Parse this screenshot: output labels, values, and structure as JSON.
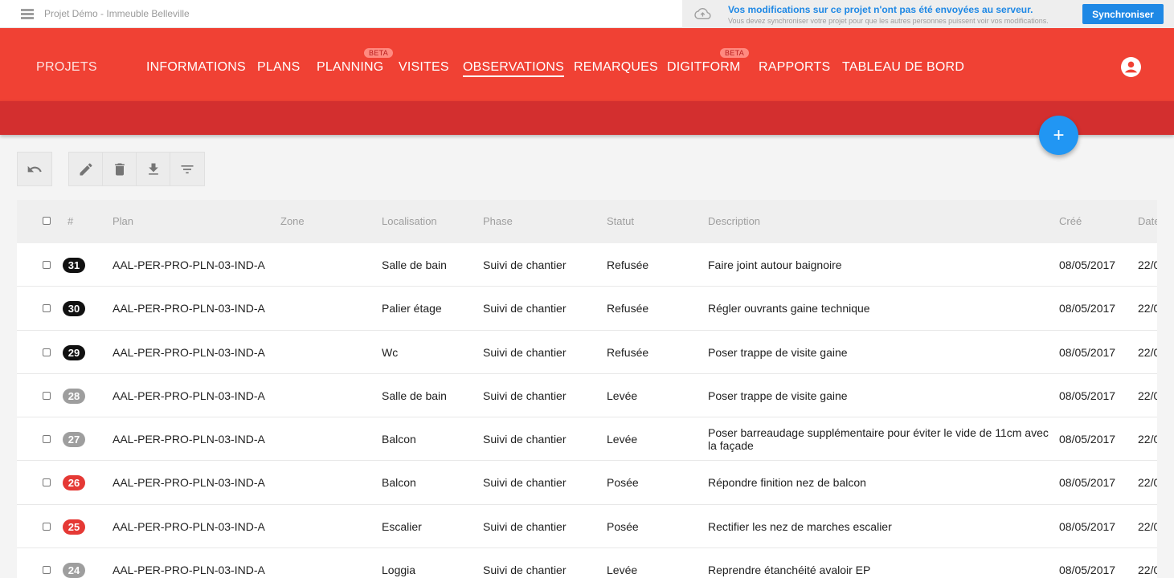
{
  "topbar": {
    "project_title": "Projet Démo - Immeuble Belleville",
    "sync_title": "Vos modifications sur ce projet n'ont pas été envoyées au serveur.",
    "sync_subtitle": "Vous devez synchroniser votre projet pour que les autres personnes puissent voir vos modifications.",
    "sync_button": "Synchroniser"
  },
  "header": {
    "projets": "PROJETS",
    "nav": [
      {
        "label": "INFORMATIONS",
        "beta": ""
      },
      {
        "label": "PLANS",
        "beta": ""
      },
      {
        "label": "PLANNING",
        "beta": "BETA"
      },
      {
        "label": "VISITES",
        "beta": ""
      },
      {
        "label": "OBSERVATIONS",
        "beta": ""
      },
      {
        "label": "REMARQUES",
        "beta": ""
      },
      {
        "label": "DIGITFORM",
        "beta": "BETA"
      },
      {
        "label": "RAPPORTS",
        "beta": ""
      },
      {
        "label": "TABLEAU DE BORD",
        "beta": ""
      }
    ],
    "active_tab": "OBSERVATIONS"
  },
  "fab_label": "+",
  "table": {
    "columns": [
      "#",
      "Plan",
      "Zone",
      "Localisation",
      "Phase",
      "Statut",
      "Description",
      "Créé",
      "Date"
    ],
    "rows": [
      {
        "num": "31",
        "badge_color": "#111111",
        "plan": "AAL-PER-PRO-PLN-03-IND-A",
        "zone": "",
        "localisation": "Salle de bain",
        "phase": "Suivi de chantier",
        "statut": "Refusée",
        "description": "Faire joint autour baignoire",
        "description2": "",
        "cree": "08/05/2017",
        "date": "22/0"
      },
      {
        "num": "30",
        "badge_color": "#111111",
        "plan": "AAL-PER-PRO-PLN-03-IND-A",
        "zone": "",
        "localisation": "Palier étage",
        "phase": "Suivi de chantier",
        "statut": "Refusée",
        "description": "Régler ouvrants gaine technique",
        "description2": "",
        "cree": "08/05/2017",
        "date": "22/0"
      },
      {
        "num": "29",
        "badge_color": "#111111",
        "plan": "AAL-PER-PRO-PLN-03-IND-A",
        "zone": "",
        "localisation": "Wc",
        "phase": "Suivi de chantier",
        "statut": "Refusée",
        "description": "Poser trappe de visite gaine",
        "description2": "",
        "cree": "08/05/2017",
        "date": "22/0"
      },
      {
        "num": "28",
        "badge_color": "#9e9e9e",
        "plan": "AAL-PER-PRO-PLN-03-IND-A",
        "zone": "",
        "localisation": "Salle de bain",
        "phase": "Suivi de chantier",
        "statut": "Levée",
        "description": "Poser trappe de visite gaine",
        "description2": "",
        "cree": "08/05/2017",
        "date": "22/0"
      },
      {
        "num": "27",
        "badge_color": "#9e9e9e",
        "plan": "AAL-PER-PRO-PLN-03-IND-A",
        "zone": "",
        "localisation": "Balcon",
        "phase": "Suivi de chantier",
        "statut": "Levée",
        "description": "Poser barreaudage supplémentaire pour éviter le vide de 11cm avec",
        "description2": "la façade",
        "cree": "08/05/2017",
        "date": "22/0"
      },
      {
        "num": "26",
        "badge_color": "#e53935",
        "plan": "AAL-PER-PRO-PLN-03-IND-A",
        "zone": "",
        "localisation": "Balcon",
        "phase": "Suivi de chantier",
        "statut": "Posée",
        "description": "Répondre finition nez de balcon",
        "description2": "",
        "cree": "08/05/2017",
        "date": "22/0"
      },
      {
        "num": "25",
        "badge_color": "#e53935",
        "plan": "AAL-PER-PRO-PLN-03-IND-A",
        "zone": "",
        "localisation": "Escalier",
        "phase": "Suivi de chantier",
        "statut": "Posée",
        "description": "Rectifier les nez de marches escalier",
        "description2": "",
        "cree": "08/05/2017",
        "date": "22/0"
      },
      {
        "num": "24",
        "badge_color": "#9e9e9e",
        "plan": "AAL-PER-PRO-PLN-03-IND-A",
        "zone": "",
        "localisation": "Loggia",
        "phase": "Suivi de chantier",
        "statut": "Levée",
        "description": "Reprendre étanchéité avaloir EP",
        "description2": "",
        "cree": "08/05/2017",
        "date": "22/0"
      }
    ]
  },
  "colors": {
    "header_red": "#f04134",
    "subheader_red": "#d32f2f",
    "accent_blue": "#1e88e5",
    "fab_blue": "#2196f3"
  }
}
